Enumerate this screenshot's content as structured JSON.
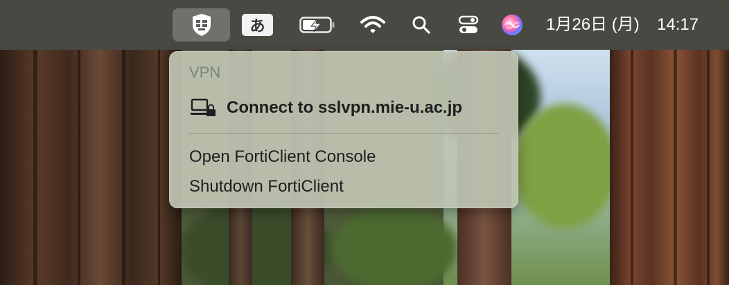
{
  "menubar": {
    "icons": {
      "forticlient": "forticlient-shield-icon",
      "input_method": "input-method-icon",
      "battery": "battery-charging-icon",
      "wifi": "wifi-icon",
      "spotlight": "search-icon",
      "control_center": "control-center-icon",
      "siri": "siri-icon"
    },
    "input_method_label": "あ",
    "date": "1月26日 (月)",
    "time": "14:17"
  },
  "vpn_menu": {
    "header": "VPN",
    "connect_label": "Connect to sslvpn.mie-u.ac.jp",
    "connect_icon": "laptop-lock-icon",
    "open_console_label": "Open FortiClient Console",
    "shutdown_label": "Shutdown FortiClient"
  },
  "colors": {
    "menubar": "#464842",
    "menu_background": "#bec4b2",
    "menu_header_text": "#7c8474",
    "menu_text": "#1e1e1e",
    "siri_gradient": [
      "#ff6fa8",
      "#7b6bff",
      "#39c6ff"
    ]
  }
}
